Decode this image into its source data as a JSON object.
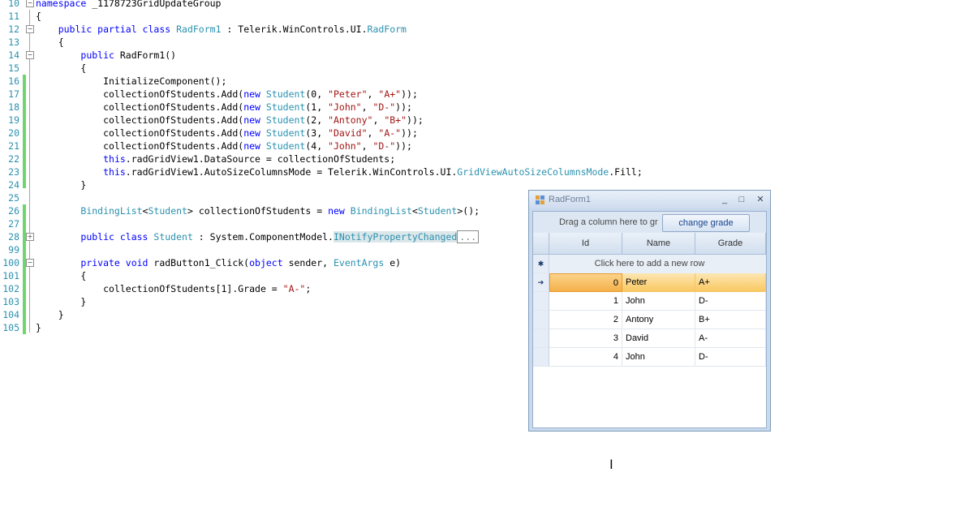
{
  "editor": {
    "lines": [
      {
        "num": "10",
        "tokens": [
          [
            "kw",
            "namespace"
          ],
          [
            "tx",
            " _1178723GridUpdateGroup"
          ]
        ]
      },
      {
        "num": "11",
        "tokens": [
          [
            "tx",
            "{"
          ]
        ]
      },
      {
        "num": "12",
        "tokens": [
          [
            "tx",
            "    "
          ],
          [
            "kw",
            "public partial class "
          ],
          [
            "ty",
            "RadForm1"
          ],
          [
            "tx",
            " : Telerik.WinControls.UI."
          ],
          [
            "ty",
            "RadForm"
          ]
        ]
      },
      {
        "num": "13",
        "tokens": [
          [
            "tx",
            "    {"
          ]
        ]
      },
      {
        "num": "14",
        "tokens": [
          [
            "tx",
            "        "
          ],
          [
            "kw",
            "public "
          ],
          [
            "tx",
            "RadForm1()"
          ]
        ]
      },
      {
        "num": "15",
        "tokens": [
          [
            "tx",
            "        {"
          ]
        ]
      },
      {
        "num": "16",
        "tokens": [
          [
            "tx",
            "            InitializeComponent();"
          ]
        ]
      },
      {
        "num": "17",
        "tokens": [
          [
            "tx",
            "            collectionOfStudents.Add("
          ],
          [
            "kw",
            "new "
          ],
          [
            "ty",
            "Student"
          ],
          [
            "tx",
            "(0, "
          ],
          [
            "st",
            "\"Peter\""
          ],
          [
            "tx",
            ", "
          ],
          [
            "st",
            "\"A+\""
          ],
          [
            "tx",
            "));"
          ]
        ]
      },
      {
        "num": "18",
        "tokens": [
          [
            "tx",
            "            collectionOfStudents.Add("
          ],
          [
            "kw",
            "new "
          ],
          [
            "ty",
            "Student"
          ],
          [
            "tx",
            "(1, "
          ],
          [
            "st",
            "\"John\""
          ],
          [
            "tx",
            ", "
          ],
          [
            "st",
            "\"D-\""
          ],
          [
            "tx",
            "));"
          ]
        ]
      },
      {
        "num": "19",
        "tokens": [
          [
            "tx",
            "            collectionOfStudents.Add("
          ],
          [
            "kw",
            "new "
          ],
          [
            "ty",
            "Student"
          ],
          [
            "tx",
            "(2, "
          ],
          [
            "st",
            "\"Antony\""
          ],
          [
            "tx",
            ", "
          ],
          [
            "st",
            "\"B+\""
          ],
          [
            "tx",
            "));"
          ]
        ]
      },
      {
        "num": "20",
        "tokens": [
          [
            "tx",
            "            collectionOfStudents.Add("
          ],
          [
            "kw",
            "new "
          ],
          [
            "ty",
            "Student"
          ],
          [
            "tx",
            "(3, "
          ],
          [
            "st",
            "\"David\""
          ],
          [
            "tx",
            ", "
          ],
          [
            "st",
            "\"A-\""
          ],
          [
            "tx",
            "));"
          ]
        ]
      },
      {
        "num": "21",
        "tokens": [
          [
            "tx",
            "            collectionOfStudents.Add("
          ],
          [
            "kw",
            "new "
          ],
          [
            "ty",
            "Student"
          ],
          [
            "tx",
            "(4, "
          ],
          [
            "st",
            "\"John\""
          ],
          [
            "tx",
            ", "
          ],
          [
            "st",
            "\"D-\""
          ],
          [
            "tx",
            "));"
          ]
        ]
      },
      {
        "num": "22",
        "tokens": [
          [
            "tx",
            "            "
          ],
          [
            "kw",
            "this"
          ],
          [
            "tx",
            ".radGridView1.DataSource = collectionOfStudents;"
          ]
        ]
      },
      {
        "num": "23",
        "tokens": [
          [
            "tx",
            "            "
          ],
          [
            "kw",
            "this"
          ],
          [
            "tx",
            ".radGridView1.AutoSizeColumnsMode = Telerik.WinControls.UI."
          ],
          [
            "ty",
            "GridViewAutoSizeColumnsMode"
          ],
          [
            "tx",
            ".Fill;"
          ]
        ]
      },
      {
        "num": "24",
        "tokens": [
          [
            "tx",
            "        }"
          ]
        ]
      },
      {
        "num": "25",
        "tokens": []
      },
      {
        "num": "26",
        "tokens": [
          [
            "tx",
            "        "
          ],
          [
            "ty",
            "BindingList"
          ],
          [
            "tx",
            "<"
          ],
          [
            "ty",
            "Student"
          ],
          [
            "tx",
            "> collectionOfStudents = "
          ],
          [
            "kw",
            "new "
          ],
          [
            "ty",
            "BindingList"
          ],
          [
            "tx",
            "<"
          ],
          [
            "ty",
            "Student"
          ],
          [
            "tx",
            ">();"
          ]
        ]
      },
      {
        "num": "27",
        "tokens": []
      },
      {
        "num": "28",
        "tokens": [
          [
            "tx",
            "        "
          ],
          [
            "kw",
            "public class "
          ],
          [
            "ty",
            "Student"
          ],
          [
            "tx",
            " : System.ComponentModel."
          ],
          [
            "hlty",
            "INotifyPropertyChanged"
          ],
          [
            "box",
            "..."
          ]
        ]
      },
      {
        "num": "99",
        "tokens": []
      },
      {
        "num": "100",
        "tokens": [
          [
            "tx",
            "        "
          ],
          [
            "kw",
            "private void "
          ],
          [
            "tx",
            "radButton1_Click("
          ],
          [
            "kw",
            "object "
          ],
          [
            "tx",
            "sender, "
          ],
          [
            "ty",
            "EventArgs"
          ],
          [
            "tx",
            " e)"
          ]
        ]
      },
      {
        "num": "101",
        "tokens": [
          [
            "tx",
            "        {"
          ]
        ]
      },
      {
        "num": "102",
        "tokens": [
          [
            "tx",
            "            collectionOfStudents[1].Grade = "
          ],
          [
            "st",
            "\"A-\""
          ],
          [
            "tx",
            ";"
          ]
        ]
      },
      {
        "num": "103",
        "tokens": [
          [
            "tx",
            "        }"
          ]
        ]
      },
      {
        "num": "104",
        "tokens": [
          [
            "tx",
            "    }"
          ]
        ]
      },
      {
        "num": "105",
        "tokens": [
          [
            "tx",
            "}"
          ]
        ]
      }
    ]
  },
  "form": {
    "title": "RadForm1",
    "minimize": "_",
    "maximize": "□",
    "close": "✕",
    "group_panel_text": "Drag a column here to gr",
    "button_label": "change grade",
    "columns": [
      "Id",
      "Name",
      "Grade"
    ],
    "new_row_text": "Click here to add a new row",
    "new_row_marker": "✱",
    "current_row_marker": "➔",
    "rows": [
      {
        "id": "0",
        "name": "Peter",
        "grade": "A+"
      },
      {
        "id": "1",
        "name": "John",
        "grade": "D-"
      },
      {
        "id": "2",
        "name": "Antony",
        "grade": "B+"
      },
      {
        "id": "3",
        "name": "David",
        "grade": "A-"
      },
      {
        "id": "4",
        "name": "John",
        "grade": "D-"
      }
    ]
  },
  "cursor_glyph": "I"
}
